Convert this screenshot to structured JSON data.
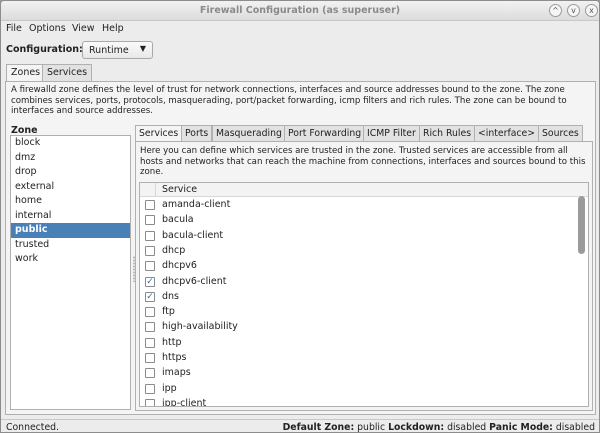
{
  "window": {
    "title": "Firewall Configuration (as superuser)",
    "controls": [
      "^",
      "v",
      "x"
    ]
  },
  "menu": [
    "File",
    "Options",
    "View",
    "Help"
  ],
  "configuration": {
    "label": "Configuration:",
    "value": "Runtime"
  },
  "top_tabs": [
    {
      "label": "Zones",
      "active": true
    },
    {
      "label": "Services",
      "active": false
    }
  ],
  "zone_description": "A firewalld zone defines the level of trust for network connections, interfaces and source addresses bound to the zone. The zone combines services, ports, protocols, masquerading, port/packet forwarding, icmp filters and rich rules. The zone can be bound to interfaces and source addresses.",
  "zones": {
    "header": "Zone",
    "items": [
      "block",
      "dmz",
      "drop",
      "external",
      "home",
      "internal",
      "public",
      "trusted",
      "work"
    ],
    "selected": "public"
  },
  "sub_tabs": [
    {
      "label": "Services",
      "active": true
    },
    {
      "label": "Ports",
      "active": false
    },
    {
      "label": "Masquerading",
      "active": false
    },
    {
      "label": "Port Forwarding",
      "active": false
    },
    {
      "label": "ICMP Filter",
      "active": false
    },
    {
      "label": "Rich Rules",
      "active": false
    },
    {
      "label": "<interface>",
      "active": false
    },
    {
      "label": "Sources",
      "active": false
    }
  ],
  "services": {
    "description": "Here you can define which services are trusted in the zone. Trusted services are accessible from all hosts and networks that can reach the machine from connections, interfaces and sources bound to this zone.",
    "column": "Service",
    "rows": [
      {
        "name": "amanda-client",
        "checked": false
      },
      {
        "name": "bacula",
        "checked": false
      },
      {
        "name": "bacula-client",
        "checked": false
      },
      {
        "name": "dhcp",
        "checked": false
      },
      {
        "name": "dhcpv6",
        "checked": false
      },
      {
        "name": "dhcpv6-client",
        "checked": true
      },
      {
        "name": "dns",
        "checked": true
      },
      {
        "name": "ftp",
        "checked": false
      },
      {
        "name": "high-availability",
        "checked": false
      },
      {
        "name": "http",
        "checked": false
      },
      {
        "name": "https",
        "checked": false
      },
      {
        "name": "imaps",
        "checked": false
      },
      {
        "name": "ipp",
        "checked": false
      },
      {
        "name": "ipp-client",
        "checked": false
      }
    ]
  },
  "status": {
    "connection": "Connected.",
    "default_zone_label": "Default Zone:",
    "default_zone": "public",
    "lockdown_label": "Lockdown:",
    "lockdown": "disabled",
    "panic_label": "Panic Mode:",
    "panic": "disabled"
  }
}
